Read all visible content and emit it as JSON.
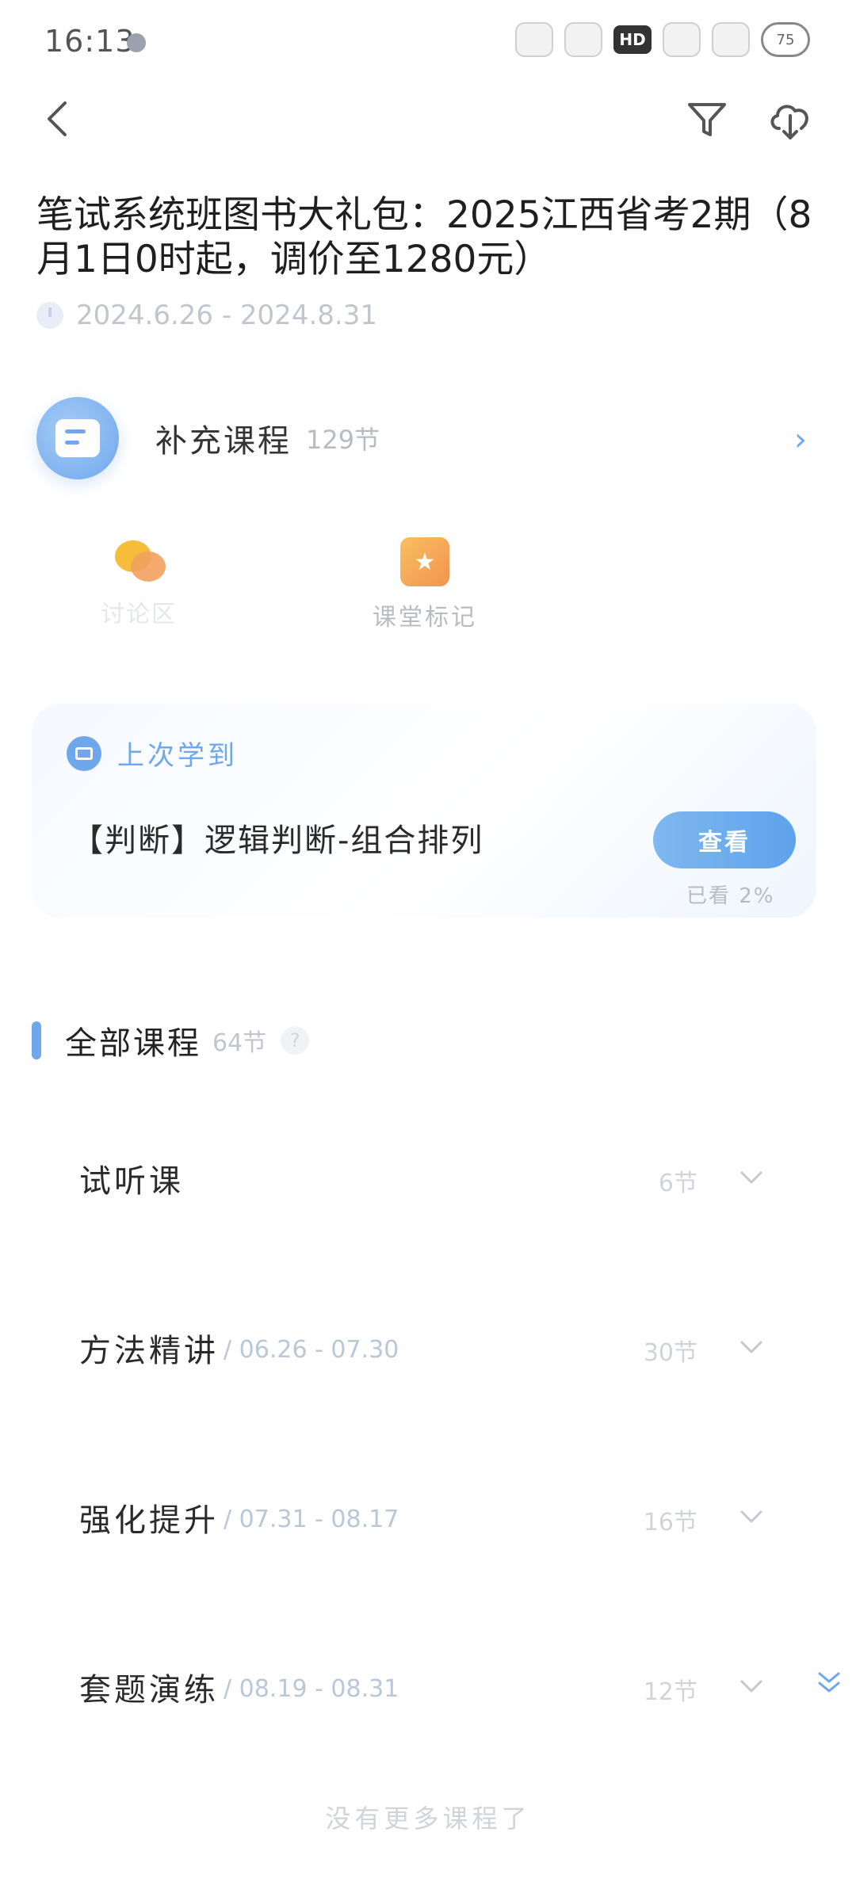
{
  "status_bar": {
    "time": "16:13",
    "hd_label": "HD",
    "signal_1": "40",
    "signal_2": "59",
    "battery": "75"
  },
  "nav": {
    "back_icon": "back-chevron-icon",
    "filter_icon": "filter-icon",
    "download_icon": "cloud-download-icon"
  },
  "course": {
    "title": "笔试系统班图书大礼包：2025江西省考2期（8月1日0时起，调价至1280元）",
    "date_range": "2024.6.26 - 2024.8.31"
  },
  "supplementary": {
    "label": "补充课程",
    "count": "129节"
  },
  "tools": {
    "discuss_label": "讨论区",
    "mark_label": "课堂标记"
  },
  "last_learned": {
    "label": "上次学到",
    "lesson": "【判断】逻辑判断-组合排列",
    "button": "查看",
    "progress": "已看 2%"
  },
  "all_courses": {
    "title": "全部课程",
    "count": "64节",
    "help": "?"
  },
  "groups": [
    {
      "name": "试听课",
      "dates": "",
      "count": "6节"
    },
    {
      "name": "方法精讲",
      "dates": "/ 06.26 - 07.30",
      "count": "30节"
    },
    {
      "name": "强化提升",
      "dates": "/ 07.31 - 08.17",
      "count": "16节"
    },
    {
      "name": "套题演练",
      "dates": "/ 08.19 - 08.31",
      "count": "12节"
    }
  ],
  "footer": "没有更多课程了",
  "colors": {
    "accent": "#6ea7ec",
    "muted": "#b8bcc2"
  }
}
